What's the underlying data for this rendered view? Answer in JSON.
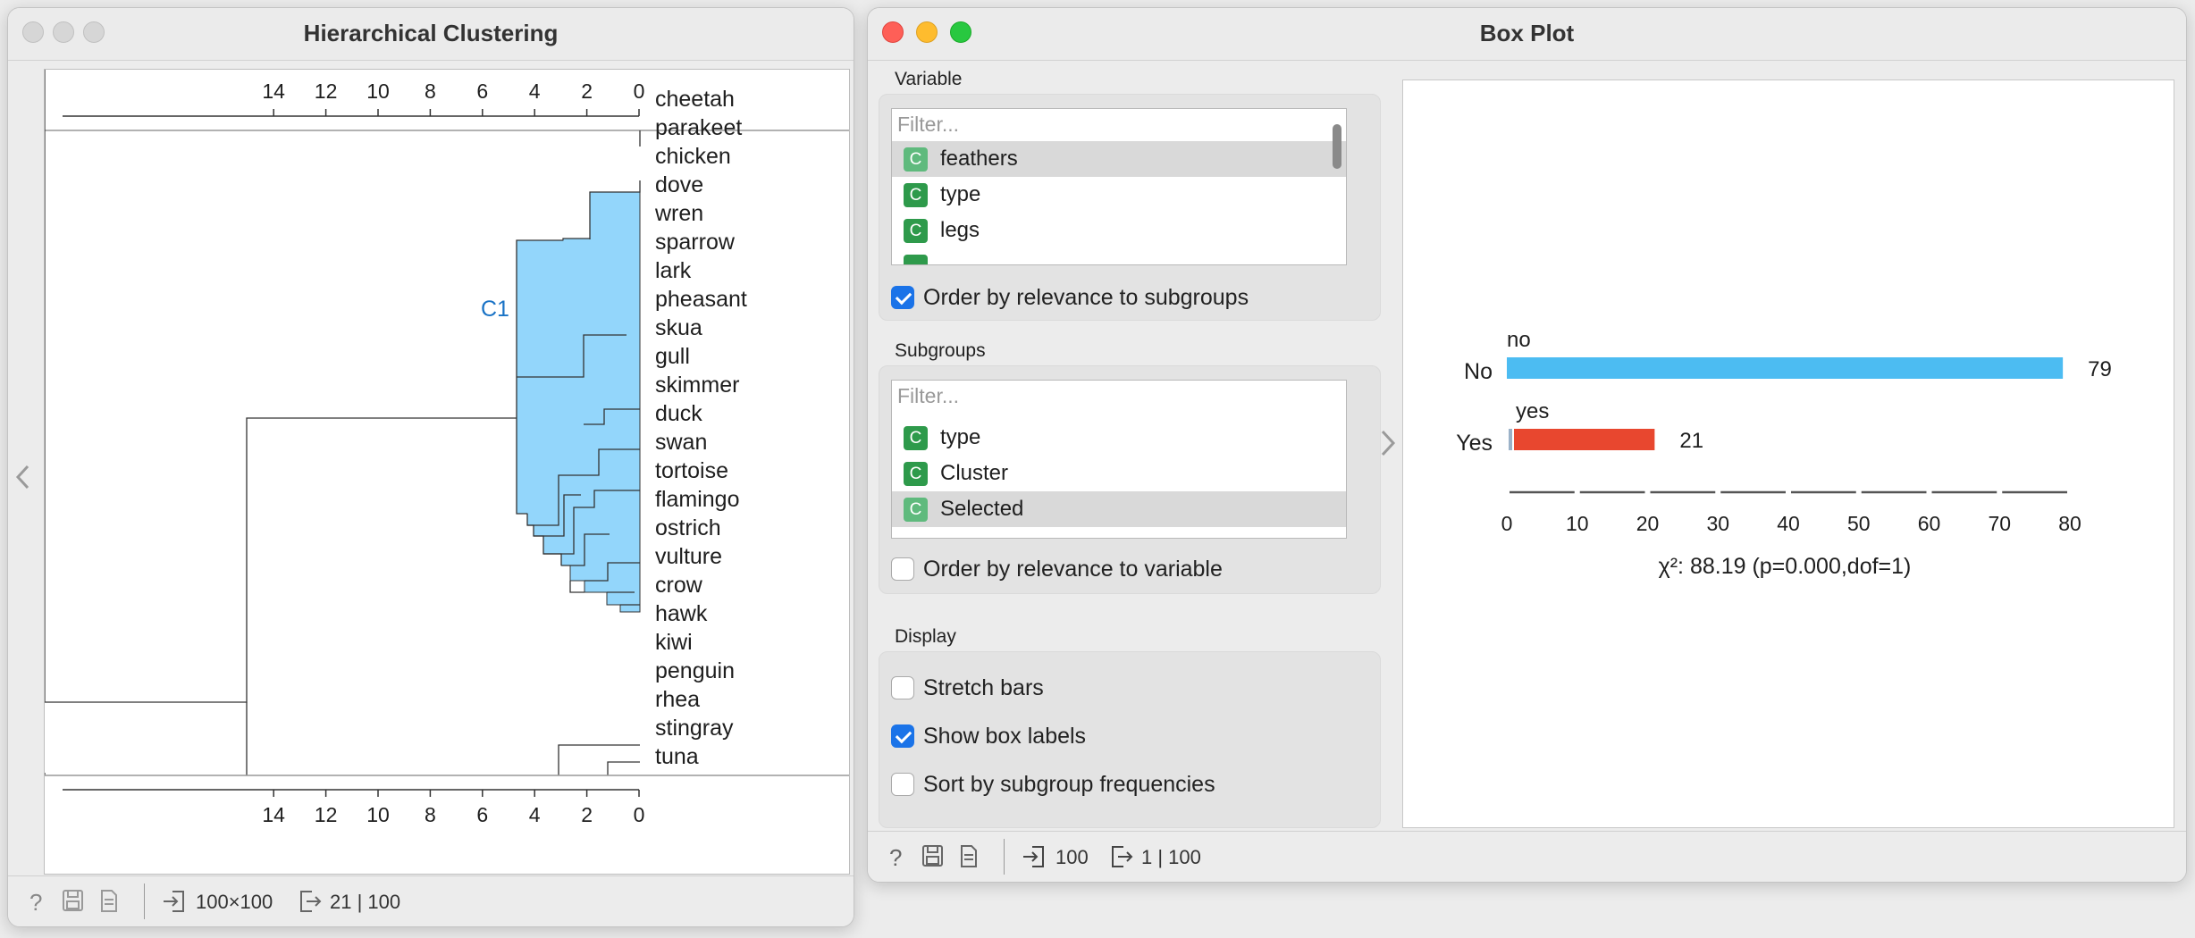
{
  "hc_window": {
    "title": "Hierarchical Clustering",
    "axis_ticks": [
      "14",
      "12",
      "10",
      "8",
      "6",
      "4",
      "2",
      "0"
    ],
    "cluster_label": "C1",
    "leaves": [
      "cheetah",
      "parakeet",
      "chicken",
      "dove",
      "wren",
      "sparrow",
      "lark",
      "pheasant",
      "skua",
      "gull",
      "skimmer",
      "duck",
      "swan",
      "tortoise",
      "flamingo",
      "ostrich",
      "vulture",
      "crow",
      "hawk",
      "kiwi",
      "penguin",
      "rhea",
      "stingray",
      "tuna"
    ],
    "status": {
      "input": "100×100",
      "output": "21 | 100"
    },
    "colors": {
      "selection": "#93d6fb"
    }
  },
  "bp_window": {
    "title": "Box Plot",
    "variable": {
      "label": "Variable",
      "filter_placeholder": "Filter...",
      "items": [
        {
          "badge": "C",
          "label": "feathers"
        },
        {
          "badge": "C",
          "label": "type"
        },
        {
          "badge": "C",
          "label": "legs"
        }
      ],
      "order_label": "Order by relevance to subgroups",
      "order_checked": true
    },
    "subgroups": {
      "label": "Subgroups",
      "filter_placeholder": "Filter...",
      "items": [
        {
          "badge": "C",
          "label": "type"
        },
        {
          "badge": "C",
          "label": "Cluster"
        },
        {
          "badge": "C",
          "label": "Selected"
        }
      ],
      "order_label": "Order by relevance to variable",
      "order_checked": false
    },
    "display": {
      "label": "Display",
      "stretch_label": "Stretch bars",
      "stretch_checked": false,
      "show_labels_label": "Show box labels",
      "show_labels_checked": true,
      "sort_label": "Sort by subgroup frequencies",
      "sort_checked": false
    },
    "status": {
      "input": "100",
      "output": "1 | 100"
    },
    "colors": {
      "no": "#4cbcf2",
      "yes": "#e8472f"
    }
  },
  "chart_data": {
    "type": "bar",
    "orientation": "horizontal",
    "categories": [
      "No",
      "Yes"
    ],
    "box_labels": [
      "no",
      "yes"
    ],
    "values": [
      79,
      21
    ],
    "xlim": [
      0,
      80
    ],
    "xticks": [
      "0",
      "10",
      "20",
      "30",
      "40",
      "50",
      "60",
      "70",
      "80"
    ],
    "annotation": "χ²: 88.19 (p=0.000,dof=1)"
  }
}
